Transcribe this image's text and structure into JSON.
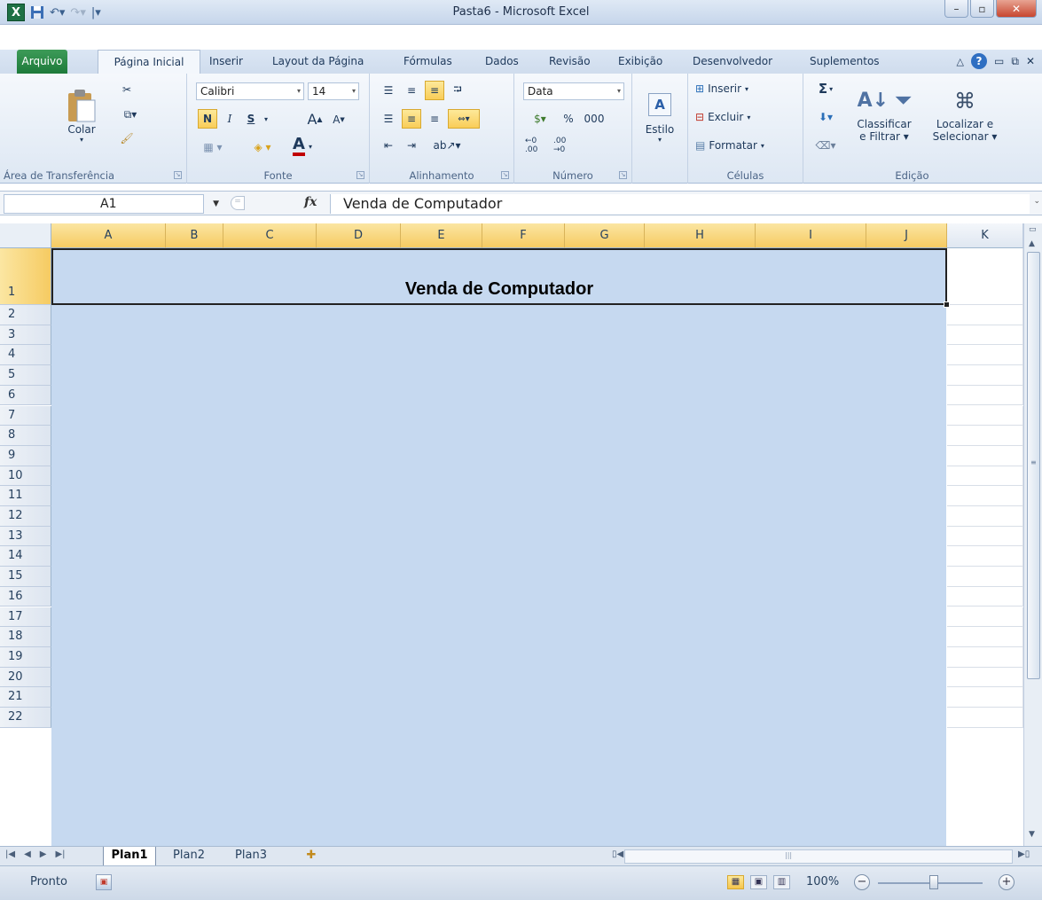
{
  "window": {
    "title": "Pasta6 - Microsoft Excel",
    "app_icon": "excel-icon",
    "controls": [
      "minimize-icon",
      "maximize-icon",
      "close-icon"
    ]
  },
  "ribbon_tabs": [
    "Arquivo",
    "Página Inicial",
    "Inserir",
    "Layout da Página",
    "Fórmulas",
    "Dados",
    "Revisão",
    "Exibição",
    "Desenvolvedor",
    "Suplementos"
  ],
  "ribbon_active_tab": "Página Inicial",
  "clipboard": {
    "paste_label": "Colar",
    "group_label": "Área de Transferência"
  },
  "font": {
    "family": "Calibri",
    "size": "14",
    "bold": "N",
    "italic": "I",
    "underline": "S",
    "grow": "A",
    "shrink": "A",
    "group_label": "Fonte",
    "font_color": "#c00000"
  },
  "alignment": {
    "group_label": "Alinhamento"
  },
  "number": {
    "format": "Data",
    "percent": "%",
    "thousands": "000",
    "group_label": "Número"
  },
  "styles": {
    "label": "Estilo"
  },
  "cells": {
    "insert": "Inserir",
    "delete": "Excluir",
    "format": "Formatar",
    "group_label": "Células"
  },
  "editing": {
    "sort_filter_line1": "Classificar",
    "sort_filter_line2": "e Filtrar",
    "find_line1": "Localizar e",
    "find_line2": "Selecionar",
    "group_label": "Edição",
    "sigma": "Σ"
  },
  "formula_bar": {
    "name_box": "A1",
    "fx": "fx",
    "content": "Venda de Computador"
  },
  "columns": [
    "A",
    "B",
    "C",
    "D",
    "E",
    "F",
    "G",
    "H",
    "I",
    "J",
    "K"
  ],
  "rows": [
    "1",
    "2",
    "3",
    "4",
    "5",
    "6",
    "7",
    "8",
    "9",
    "10",
    "11",
    "12",
    "13",
    "14",
    "15",
    "16",
    "17",
    "18",
    "19",
    "20",
    "21",
    "22"
  ],
  "sheet": {
    "merged_cell_text": "Venda de Computador",
    "fill_color": "#c6d9f0"
  },
  "sheet_tabs": [
    "Plan1",
    "Plan2",
    "Plan3"
  ],
  "active_sheet": "Plan1",
  "status": {
    "text": "Pronto",
    "zoom": "100%"
  }
}
